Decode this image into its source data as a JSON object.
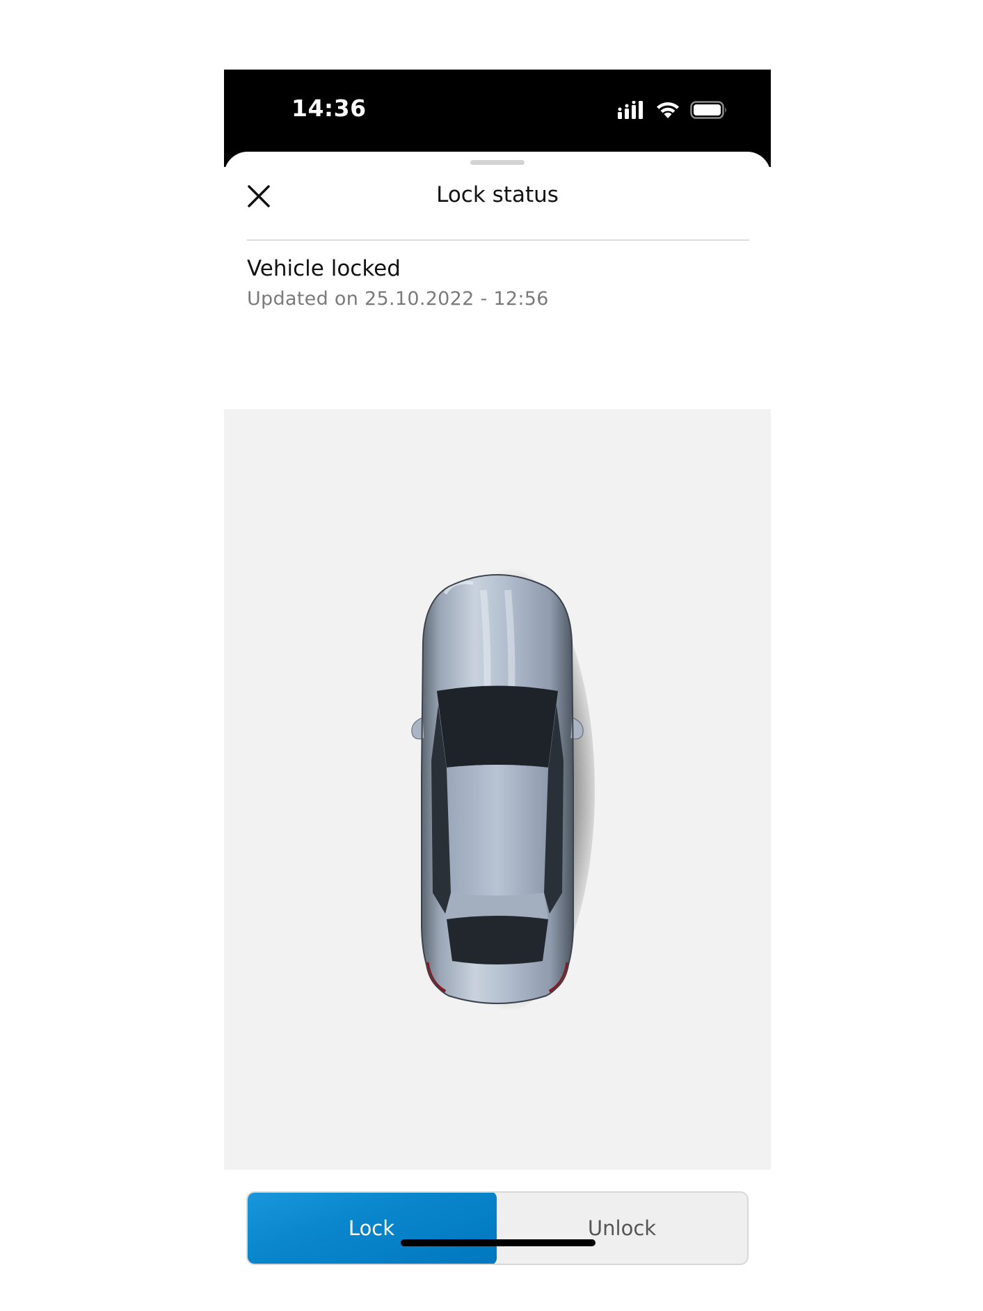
{
  "status_bar": {
    "time": "14:36",
    "icons": [
      "signal-icon",
      "wifi-icon",
      "battery-icon"
    ]
  },
  "sheet": {
    "title": "Lock status",
    "close_icon": "close-icon"
  },
  "lock_state": {
    "heading": "Vehicle locked",
    "updated": "Updated on 25.10.2022 - 12:56"
  },
  "vehicle": {
    "image": "car-top-view"
  },
  "actions": {
    "lock_label": "Lock",
    "unlock_label": "Unlock",
    "selected": "Lock",
    "accent_color": "#0a86cc"
  }
}
